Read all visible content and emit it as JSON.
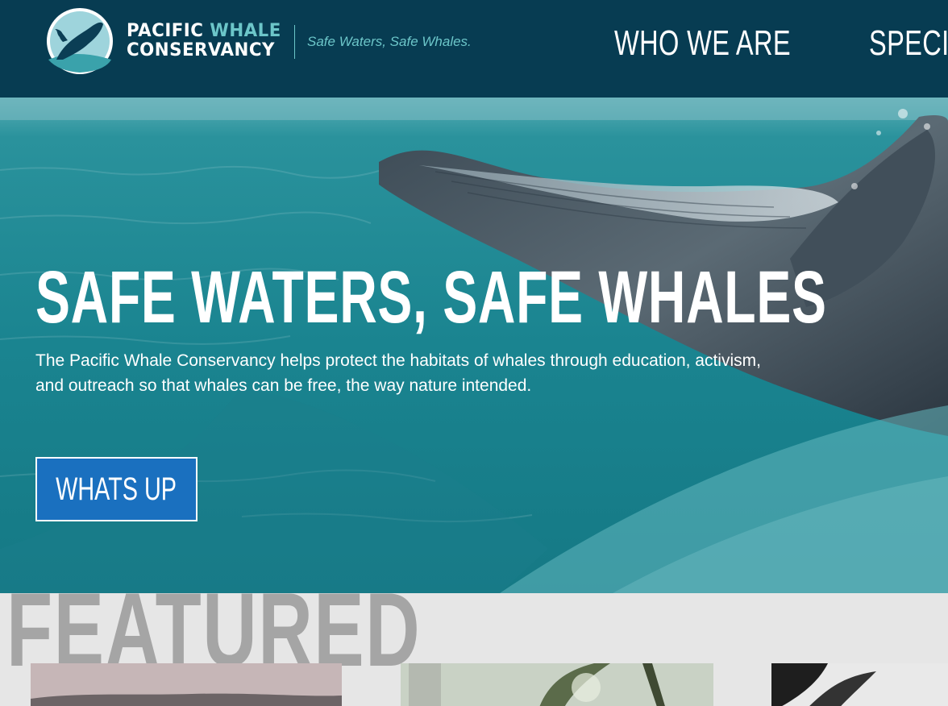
{
  "header": {
    "brand_line1_a": "PACIFIC",
    "brand_line1_b": "WHALE",
    "brand_line2": "CONSERVANCY",
    "tagline": "Safe Waters, Safe Whales.",
    "logo_icon": "whale-logo-icon",
    "nav": [
      {
        "label": "WHO WE ARE"
      },
      {
        "label": "SPECIES"
      }
    ]
  },
  "hero": {
    "title": "SAFE WATERS, SAFE WHALES",
    "text": "The Pacific Whale Conservancy helps protect the habitats of whales through education, activism, and outreach so that whales can be free, the way nature intended.",
    "cta_label": "WHATS UP",
    "image": "humpback-whale-breach-photo"
  },
  "featured": {
    "title": "FEATURED",
    "cards": [
      {
        "image": "featured-photo-1"
      },
      {
        "image": "featured-photo-2"
      },
      {
        "image": "featured-photo-3"
      }
    ]
  },
  "colors": {
    "header_bg": "#073c52",
    "accent_teal": "#6cc6c9",
    "cta_blue": "#1a70bf",
    "featured_gray": "#a5a5a5"
  }
}
